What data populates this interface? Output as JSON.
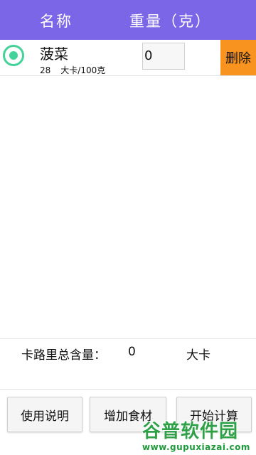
{
  "header": {
    "col_name": "名称",
    "col_weight": "重量（克）"
  },
  "foods": [
    {
      "name": "菠菜",
      "calories": "28",
      "cal_unit": "大卡/100克",
      "weight": "0",
      "selected": true,
      "delete_label": "删除"
    }
  ],
  "total": {
    "label": "卡路里总含量：",
    "value": "0",
    "unit": "大卡"
  },
  "buttons": {
    "help": "使用说明",
    "add": "增加食材",
    "start": "开始计算"
  },
  "watermark": {
    "title": "谷普软件园",
    "url": "www.gupuxiazai.com"
  },
  "colors": {
    "header": "#7b66e8",
    "radio": "#43d39a",
    "delete": "#f7931e"
  }
}
